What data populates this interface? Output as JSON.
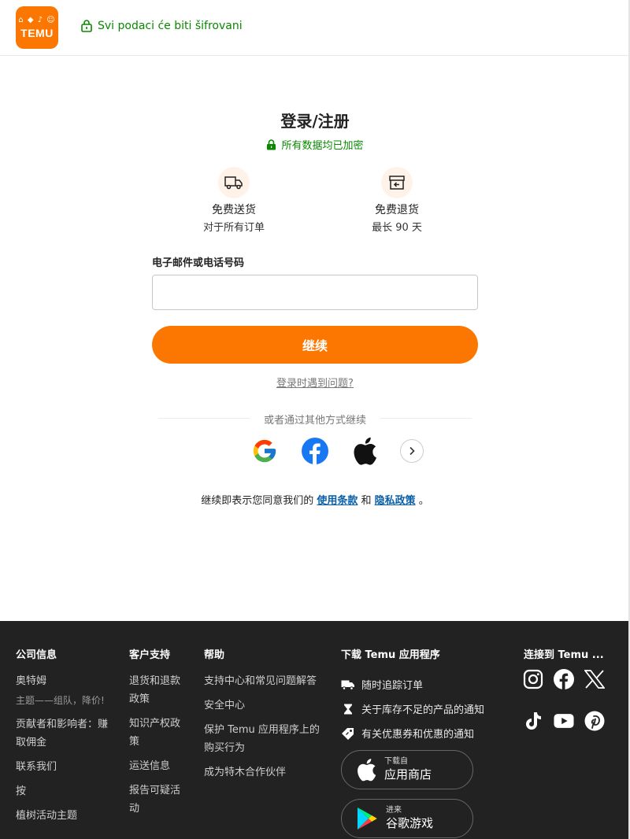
{
  "header": {
    "logo_mini": "⌂ ◆ ♪ ☺",
    "logo_text": "TEMU",
    "secure_text": "Svi podaci će biti šifrovani"
  },
  "login": {
    "title": "登录/注册",
    "encrypted_text": "所有数据均已加密",
    "benefits": [
      {
        "title": "免费送货",
        "subtitle": "对于所有订单"
      },
      {
        "title": "免费退货",
        "subtitle": "最长 90 天"
      }
    ],
    "field_label": "电子邮件或电话号码",
    "field_value": "",
    "continue_label": "继续",
    "trouble_link": "登录时遇到问题?",
    "or_text": "或者通过其他方式继续",
    "terms_prefix": "继续即表示您同意我们的 ",
    "terms_link": "使用条款",
    "terms_and": " 和 ",
    "privacy_link": "隐私政策",
    "terms_suffix": " 。"
  },
  "footer": {
    "company": {
      "heading": "公司信息",
      "items": [
        "奥特姆"
      ],
      "small": "主题——组队，降价!",
      "items2": [
        "贡献者和影响者：赚取佣金",
        "联系我们",
        "按",
        "植树活动主题"
      ]
    },
    "support": {
      "heading": "客户支持",
      "items": [
        "退货和退款政策",
        "知识产权政策",
        "运送信息",
        "报告可疑活动"
      ]
    },
    "help": {
      "heading": "帮助",
      "items": [
        "支持中心和常见问题解答",
        "安全中心",
        "保护 Temu 应用程序上的购买行为",
        "成为特木合作伙伴"
      ]
    },
    "download": {
      "heading": "下载 Temu 应用程序",
      "features": [
        "随时追踪订单",
        "关于库存不足的产品的通知",
        "有关优惠券和优惠的通知"
      ],
      "app_store_small": "下载自",
      "app_store_big": "应用商店",
      "play_small": "进来",
      "play_big": "谷歌游戏"
    },
    "connect": {
      "heading": "连接到 Temu ..."
    }
  },
  "colors": {
    "brand_orange": "#fb7701",
    "secure_green": "#0a8800",
    "footer_bg": "#222222",
    "link_blue": "#0a5fa8"
  }
}
